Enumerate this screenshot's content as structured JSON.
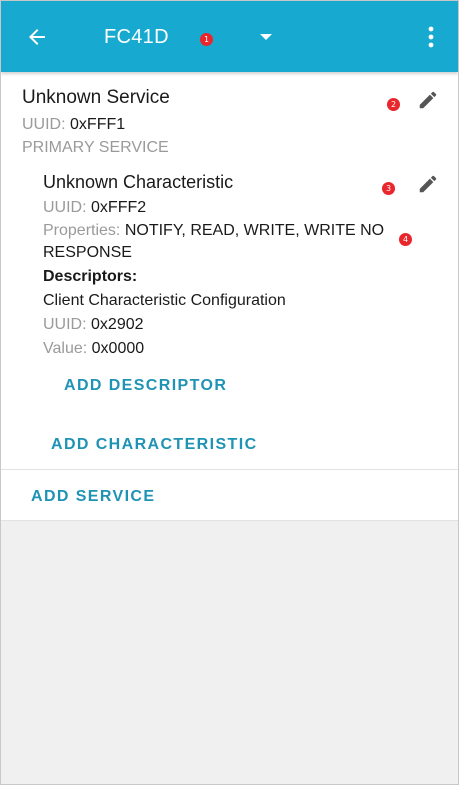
{
  "appbar": {
    "title": "FC41D",
    "back_icon": "arrow-back-icon",
    "dropdown_icon": "caret-down-icon",
    "menu_icon": "more-vert-icon"
  },
  "markers": [
    "1",
    "2",
    "3",
    "4"
  ],
  "service": {
    "name": "Unknown Service",
    "uuid_label": "UUID:",
    "uuid_value": "0xFFF1",
    "type": "PRIMARY SERVICE",
    "edit_icon": "pencil-icon"
  },
  "characteristic": {
    "name": "Unknown Characteristic",
    "uuid_label": "UUID:",
    "uuid_value": "0xFFF2",
    "properties_label": "Properties:",
    "properties_value_line1": "NOTIFY, READ, WRITE, WRITE NO",
    "properties_value_line2": "RESPONSE",
    "edit_icon": "pencil-icon"
  },
  "descriptors": {
    "heading": "Descriptors:",
    "name": "Client Characteristic Configuration",
    "uuid_label": "UUID:",
    "uuid_value": "0x2902",
    "value_label": "Value:",
    "value_value": "0x0000"
  },
  "actions": {
    "add_descriptor": "ADD DESCRIPTOR",
    "add_characteristic": "ADD CHARACTERISTIC",
    "add_service": "ADD SERVICE"
  },
  "colors": {
    "appbar": "#17a9cf",
    "action_text": "#1f93b4",
    "marker": "#e8262b",
    "background": "#f0f0f0"
  }
}
